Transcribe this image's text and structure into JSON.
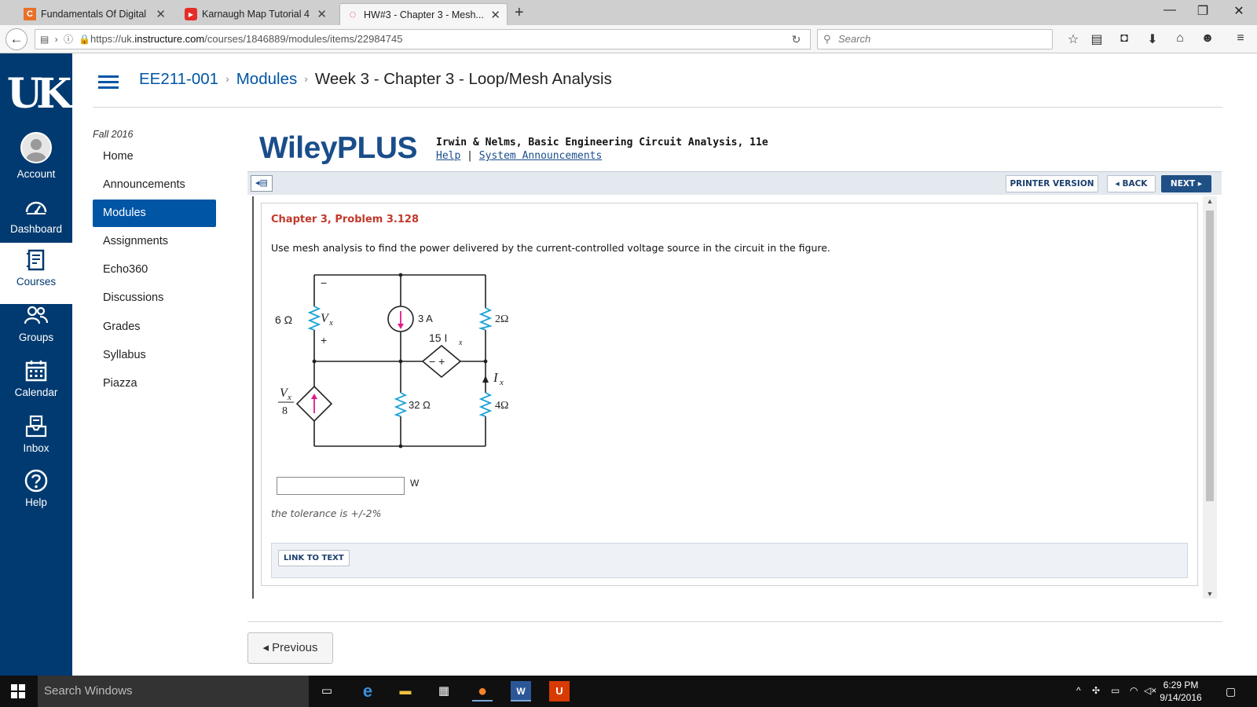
{
  "browser": {
    "tabs": [
      {
        "title": "Fundamentals Of Digital L...",
        "favicon_color": "#e8712a",
        "favicon_glyph": "C",
        "active": false
      },
      {
        "title": "Karnaugh Map Tutorial 4 ...",
        "favicon_color": "#e52d27",
        "favicon_glyph": "▶",
        "active": false
      },
      {
        "title": "HW#3 - Chapter 3 - Mesh...",
        "favicon_color": "#d22",
        "favicon_glyph": "◌",
        "active": true
      }
    ],
    "new_tab": "+",
    "url_prefix": "https://uk.",
    "url_host": "instructure.com",
    "url_path": "/courses/1846889/modules/items/22984745",
    "search_placeholder": "Search",
    "window_controls": {
      "minimize": "—",
      "maximize": "❐",
      "close": "✕"
    }
  },
  "global_nav": {
    "logo": "UK",
    "items": [
      {
        "label": "Account",
        "icon": "account-icon"
      },
      {
        "label": "Dashboard",
        "icon": "dashboard-icon"
      },
      {
        "label": "Courses",
        "icon": "courses-icon",
        "active": true
      },
      {
        "label": "Groups",
        "icon": "groups-icon"
      },
      {
        "label": "Calendar",
        "icon": "calendar-icon"
      },
      {
        "label": "Inbox",
        "icon": "inbox-icon"
      },
      {
        "label": "Help",
        "icon": "help-icon"
      }
    ],
    "colors": {
      "background": "#003a70",
      "active_text": "#003a70"
    }
  },
  "breadcrumb": {
    "course": "EE211-001",
    "section": "Modules",
    "current": "Week 3 - Chapter 3 - Loop/Mesh Analysis",
    "separator": "›"
  },
  "course_nav": {
    "term": "Fall 2016",
    "items": [
      {
        "label": "Home"
      },
      {
        "label": "Announcements"
      },
      {
        "label": "Modules",
        "active": true
      },
      {
        "label": "Assignments"
      },
      {
        "label": "Echo360"
      },
      {
        "label": "Discussions"
      },
      {
        "label": "Grades"
      },
      {
        "label": "Syllabus"
      },
      {
        "label": "Piazza"
      }
    ]
  },
  "wiley": {
    "logo": "WileyPLUS",
    "book": "Irwin & Nelms, Basic Engineering Circuit Analysis, 11e",
    "help_link": "Help",
    "link_sep": "|",
    "announce_link": "System Announcements",
    "printer_btn": "PRINTER VERSION",
    "back_btn": "◂ BACK",
    "next_btn": "NEXT ▸"
  },
  "problem": {
    "title": "Chapter 3, Problem 3.128",
    "text": "Use mesh analysis to find the power delivered by the current-controlled voltage source in the circuit in the figure.",
    "answer_value": "",
    "unit": "W",
    "tolerance": "the tolerance is +/-2%",
    "link_to_text": "LINK TO TEXT"
  },
  "circuit": {
    "r1": "6 Ω",
    "vx": "V",
    "vx_sub": "x",
    "minus": "−",
    "plus": "+",
    "cs_value": "3 A",
    "r2": "2Ω",
    "ccvs_gain": "15 I",
    "ccvs_sub": "x",
    "ccvs_signs": "−+",
    "ix": "I",
    "ix_sub": "x",
    "dep_num": "V",
    "dep_num_sub": "x",
    "dep_den": "8",
    "r3": "32 Ω",
    "r4": "4Ω"
  },
  "footer": {
    "previous_btn": "◂ Previous"
  },
  "taskbar": {
    "search": "Search Windows",
    "time": "6:29 PM",
    "date": "9/14/2016"
  }
}
